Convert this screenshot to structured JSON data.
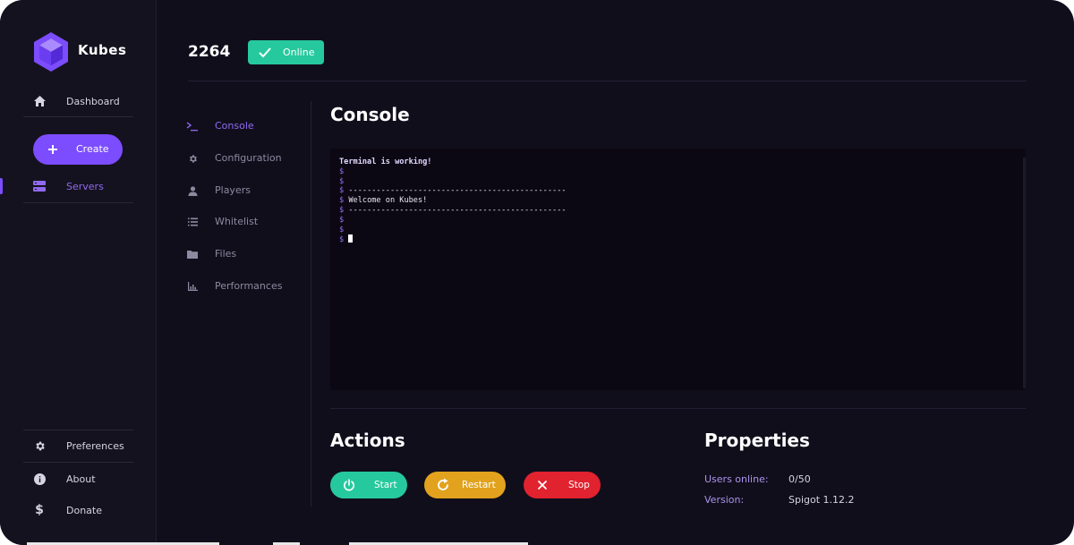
{
  "app": {
    "name": "Kubes"
  },
  "sidebar": {
    "items": [
      {
        "label": "Dashboard",
        "icon": "home-icon"
      },
      {
        "label": "Servers",
        "icon": "server-icon",
        "active": true
      }
    ],
    "create_label": "Create",
    "footer": [
      {
        "label": "Preferences",
        "icon": "gear-icon"
      },
      {
        "label": "About",
        "icon": "info-icon"
      },
      {
        "label": "Donate",
        "icon": "dollar-icon"
      }
    ]
  },
  "header": {
    "server_name": "2264",
    "status": "Online"
  },
  "subnav": [
    {
      "label": "Console",
      "icon": "terminal-icon",
      "active": true
    },
    {
      "label": "Configuration",
      "icon": "gear-icon"
    },
    {
      "label": "Players",
      "icon": "user-icon"
    },
    {
      "label": "Whitelist",
      "icon": "list-icon"
    },
    {
      "label": "Files",
      "icon": "folder-icon"
    },
    {
      "label": "Performances",
      "icon": "chart-icon"
    }
  ],
  "console": {
    "title": "Console",
    "lines": [
      {
        "prompt": "",
        "text": "Terminal is working!"
      },
      {
        "prompt": "$",
        "text": ""
      },
      {
        "prompt": "$",
        "text": ""
      },
      {
        "prompt": "$",
        "text": "-----------------------------------------------"
      },
      {
        "prompt": "$",
        "text": "Welcome on Kubes!"
      },
      {
        "prompt": "$",
        "text": "-----------------------------------------------"
      },
      {
        "prompt": "$",
        "text": ""
      },
      {
        "prompt": "$",
        "text": ""
      },
      {
        "prompt": "$",
        "text": ""
      }
    ]
  },
  "actions": {
    "title": "Actions",
    "start": "Start",
    "restart": "Restart",
    "stop": "Stop"
  },
  "properties": {
    "title": "Properties",
    "users_label": "Users online:",
    "users_value": "0/50",
    "version_label": "Version:",
    "version_value": "Spigot 1.12.2"
  },
  "colors": {
    "accent": "#7c4dff",
    "online": "#26c99d",
    "restart": "#e2a21d",
    "stop": "#e1222f",
    "background": "#110e1c"
  }
}
